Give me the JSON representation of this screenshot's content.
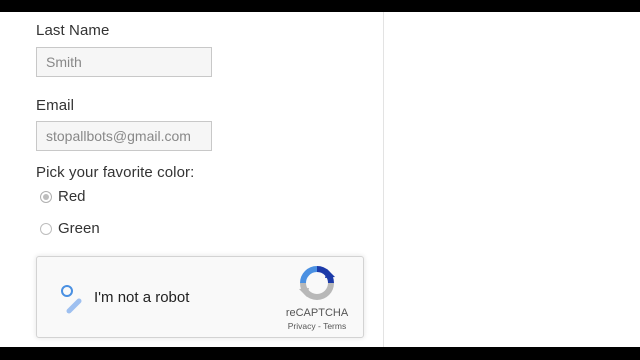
{
  "form": {
    "last_name": {
      "label": "Last Name",
      "value": "Smith"
    },
    "email": {
      "label": "Email",
      "value": "stopallbots@gmail.com"
    },
    "color": {
      "question": "Pick your favorite color:",
      "options": [
        {
          "label": "Red",
          "checked": true
        },
        {
          "label": "Green",
          "checked": false
        }
      ]
    }
  },
  "captcha": {
    "label": "I'm not a robot",
    "brand": "reCAPTCHA",
    "privacy": "Privacy",
    "separator": "-",
    "terms": "Terms",
    "logo_icon": "recaptcha-logo-icon",
    "spinner_icon": "loading-spinner-icon"
  },
  "colors": {
    "page_bg": "#ffffff",
    "input_bg": "#f6f6f6",
    "captcha_bg": "#f9f9f9",
    "recaptcha_blue": "#4a90e2",
    "recaptcha_gray": "#b8b8b8"
  }
}
